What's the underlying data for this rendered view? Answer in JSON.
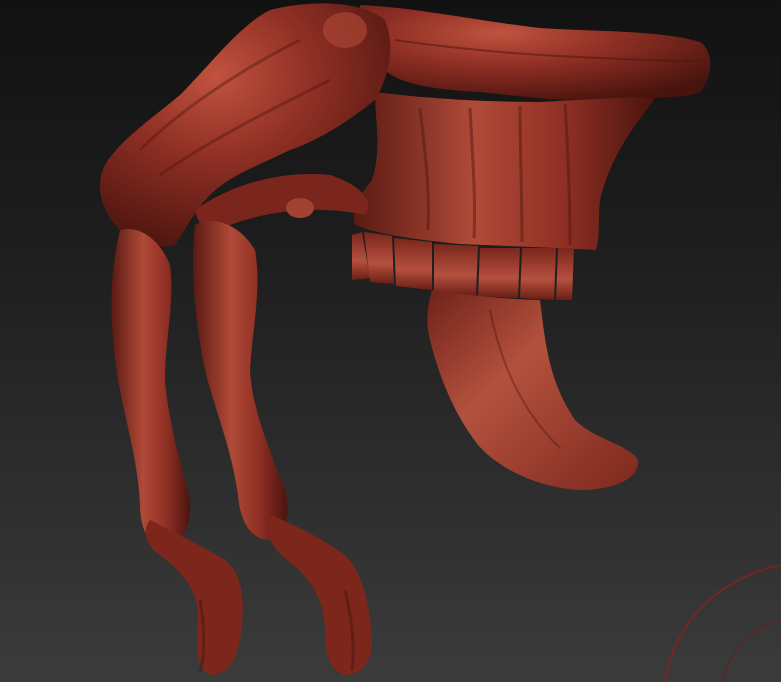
{
  "viewport": {
    "background_top": "#121212",
    "background_bottom": "#3b3b3b"
  },
  "model": {
    "material_color": "#8f2f24",
    "highlight_color": "#c0533f",
    "shadow_color": "#4a140e",
    "tooth_color": "#a8473a"
  },
  "gizmo": {
    "ring_color": "#8a1f1f"
  }
}
